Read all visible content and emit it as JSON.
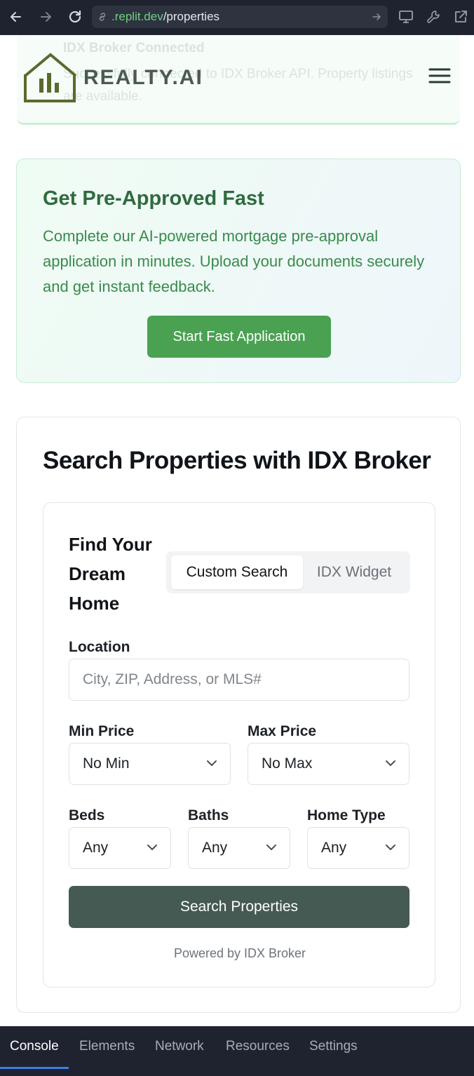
{
  "browser": {
    "url_host": ".replit.dev",
    "url_path": "/properties"
  },
  "toast": {
    "title": "IDX Broker Connected",
    "description": "Successfully connected to IDX Broker API. Property listings are available."
  },
  "header": {
    "brand": "REALTY.AI"
  },
  "preapproval": {
    "title": "Get Pre-Approved Fast",
    "description": "Complete our AI-powered mortgage pre-approval application in minutes. Upload your documents securely and get instant feedback.",
    "button": "Start Fast Application"
  },
  "search": {
    "title": "Search Properties with IDX Broker",
    "find_title": "Find Your Dream Home",
    "tabs": [
      {
        "label": "Custom Search",
        "active": true
      },
      {
        "label": "IDX Widget",
        "active": false
      }
    ],
    "location": {
      "label": "Location",
      "placeholder": "City, ZIP, Address, or MLS#"
    },
    "min_price": {
      "label": "Min Price",
      "value": "No Min"
    },
    "max_price": {
      "label": "Max Price",
      "value": "No Max"
    },
    "beds": {
      "label": "Beds",
      "value": "Any"
    },
    "baths": {
      "label": "Baths",
      "value": "Any"
    },
    "home_type": {
      "label": "Home Type",
      "value": "Any"
    },
    "submit": "Search Properties",
    "powered_by": "Powered by IDX Broker"
  },
  "devtools": {
    "tabs": [
      "Console",
      "Elements",
      "Network",
      "Resources",
      "Settings"
    ],
    "active": "Console"
  },
  "colors": {
    "chrome_bg": "#1f2330",
    "brand_green": "#4aa152",
    "heading_green": "#2f6b3f",
    "search_button": "#455a53",
    "logo_olive": "#5a6a2e"
  }
}
